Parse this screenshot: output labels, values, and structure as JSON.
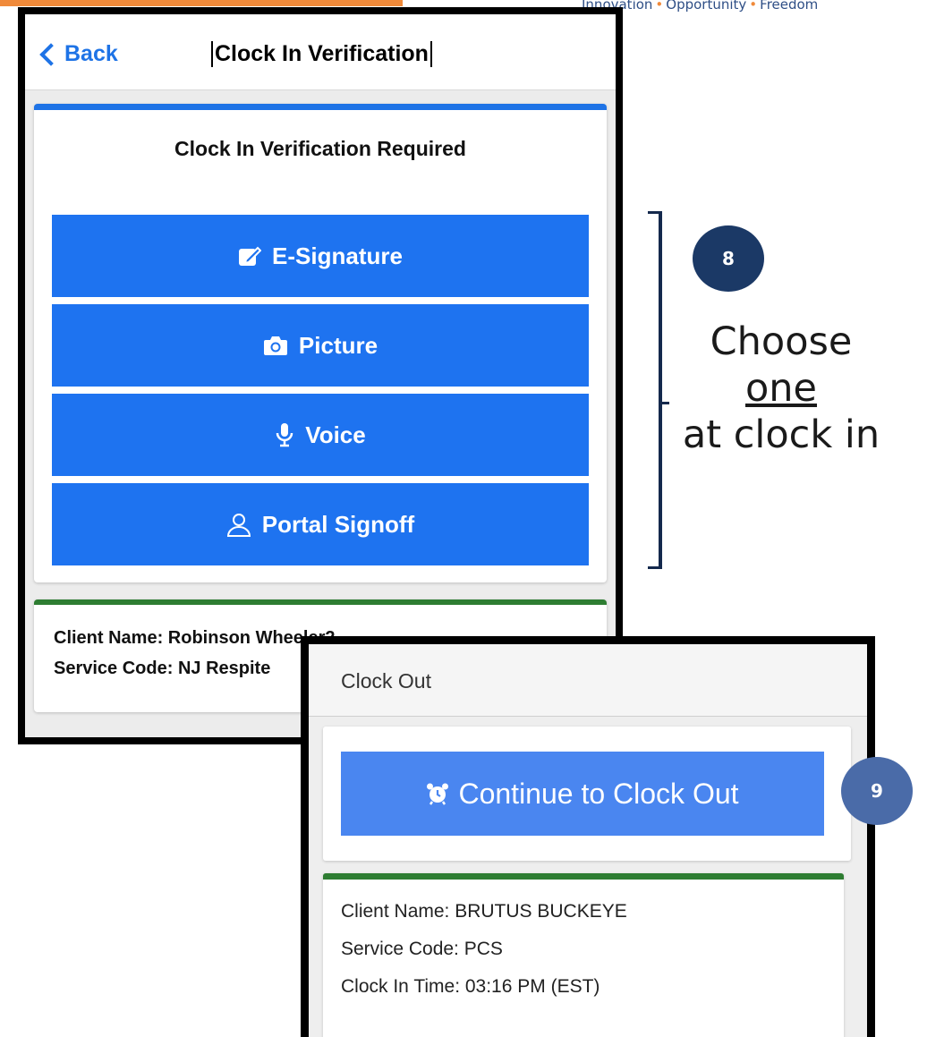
{
  "branding": {
    "tagline_parts": [
      "Innovation",
      "Opportunity",
      "Freedom"
    ],
    "tagline_separator": "•",
    "accent_orange": "#f08a3a"
  },
  "clock_in_screen": {
    "back_label": "Back",
    "title": "Clock In Verification",
    "card_title": "Clock In Verification Required",
    "options": [
      {
        "label": "E-Signature",
        "icon": "edit-icon"
      },
      {
        "label": "Picture",
        "icon": "camera-icon"
      },
      {
        "label": "Voice",
        "icon": "microphone-icon"
      },
      {
        "label": "Portal Signoff",
        "icon": "user-icon"
      }
    ],
    "client_name": "Client Name: Robinson Wheeler2",
    "service_code": "Service Code: NJ Respite",
    "accent_blue": "#1e73f0",
    "accent_green": "#2e7d32"
  },
  "annotation": {
    "step8": "8",
    "callout_prefix": "Choose ",
    "callout_emphasis": "one",
    "callout_suffix": "at clock in",
    "step9": "9"
  },
  "clock_out_screen": {
    "title": "Clock Out",
    "button_label": "Continue to Clock Out",
    "button_icon": "alarm-clock-icon",
    "client_name": "Client Name: BRUTUS BUCKEYE",
    "service_code": "Service Code: PCS",
    "clock_in_time": "Clock In Time: 03:16 PM (EST)"
  }
}
